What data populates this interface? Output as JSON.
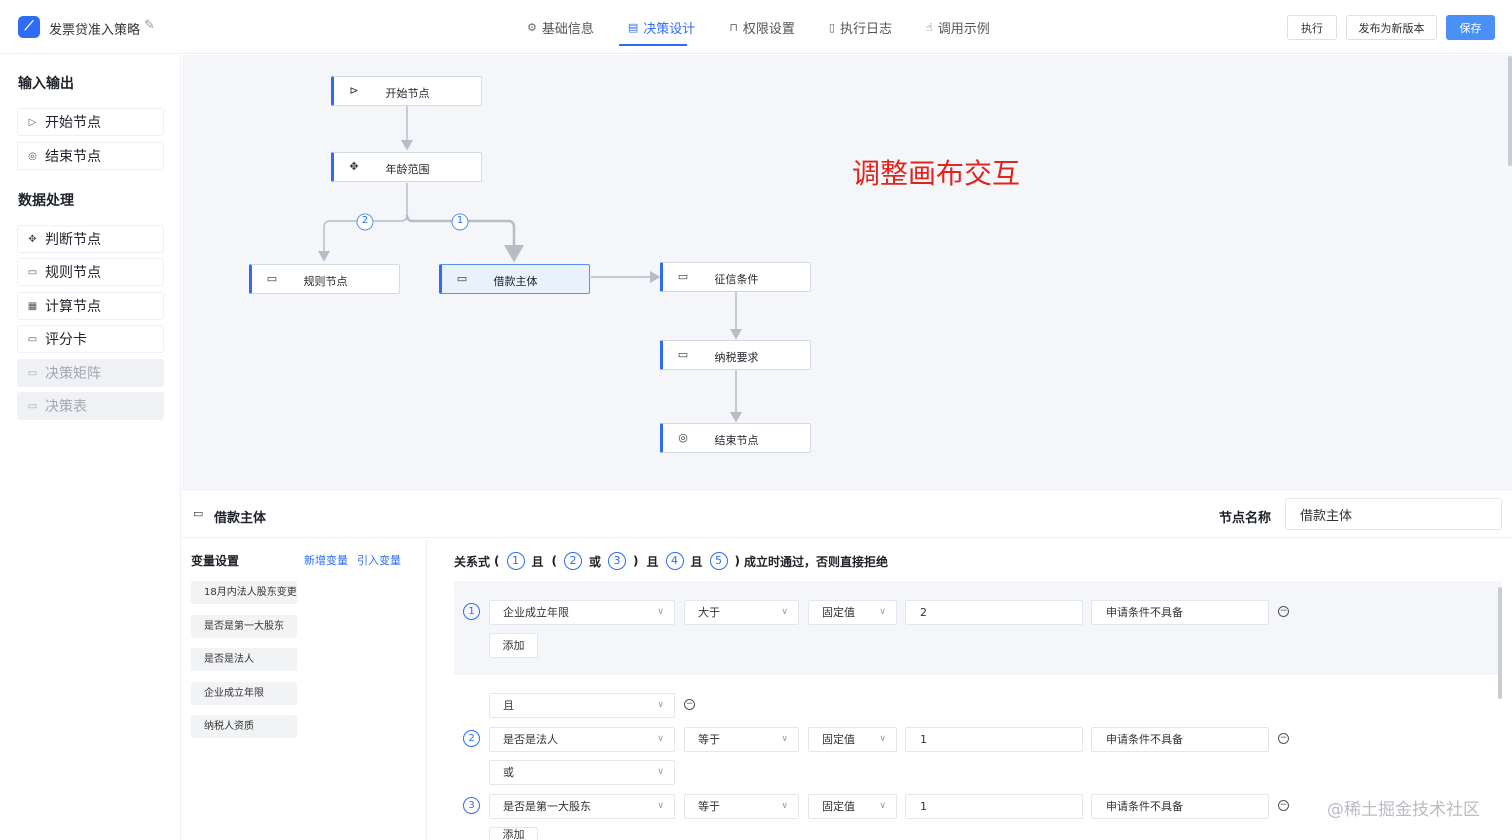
{
  "header": {
    "app_title": "发票贷准入策略",
    "tabs": [
      {
        "label": "基础信息",
        "icon": "settings-icon"
      },
      {
        "label": "决策设计",
        "icon": "design-icon"
      },
      {
        "label": "权限设置",
        "icon": "lock-icon"
      },
      {
        "label": "执行日志",
        "icon": "log-icon"
      },
      {
        "label": "调用示例",
        "icon": "hand-icon"
      }
    ],
    "active_tab": "决策设计",
    "buttons": {
      "run": "执行",
      "publish": "发布为新版本",
      "save": "保存"
    }
  },
  "sidebar": {
    "groups": [
      {
        "title": "输入输出",
        "items": [
          {
            "label": "开始节点",
            "icon": "play-icon"
          },
          {
            "label": "结束节点",
            "icon": "stop-icon"
          }
        ]
      },
      {
        "title": "数据处理",
        "items": [
          {
            "label": "判断节点",
            "icon": "move-icon"
          },
          {
            "label": "规则节点",
            "icon": "card-icon"
          },
          {
            "label": "计算节点",
            "icon": "calculator-icon"
          },
          {
            "label": "评分卡",
            "icon": "card-icon"
          },
          {
            "label": "决策矩阵",
            "icon": "card-icon",
            "disabled": true
          },
          {
            "label": "决策表",
            "icon": "card-icon",
            "disabled": true
          }
        ]
      }
    ]
  },
  "canvas": {
    "nodes": [
      {
        "id": "start",
        "label": "开始节点",
        "icon": "play-icon"
      },
      {
        "id": "age",
        "label": "年龄范围",
        "icon": "move-icon"
      },
      {
        "id": "rule",
        "label": "规则节点",
        "icon": "card-icon"
      },
      {
        "id": "borrower",
        "label": "借款主体",
        "icon": "card-icon",
        "selected": true
      },
      {
        "id": "credit",
        "label": "征信条件",
        "icon": "card-icon"
      },
      {
        "id": "tax",
        "label": "纳税要求",
        "icon": "card-icon"
      },
      {
        "id": "end",
        "label": "结束节点",
        "icon": "stop-icon"
      }
    ],
    "branch_labels": [
      "2",
      "1"
    ],
    "annotation": "调整画布交互"
  },
  "panel": {
    "title": "借款主体",
    "node_name_label": "节点名称",
    "node_name_value": "借款主体",
    "variables": {
      "title": "变量设置",
      "add_link": "新增变量",
      "import_link": "引入变量",
      "items": [
        "18月内法人股东变更",
        "是否是第一大股东",
        "是否是法人",
        "企业成立年限",
        "纳税人资质"
      ]
    },
    "formula": {
      "prefix": "关系式",
      "open": "(",
      "close": ")",
      "w_and": "且",
      "w_or": "或",
      "suffix": "成立时通过，否则直接拒绝",
      "n1": "1",
      "n2": "2",
      "n3": "3",
      "n4": "4",
      "n5": "5"
    },
    "conditions": [
      {
        "num": "1",
        "field": "企业成立年限",
        "op": "大于",
        "type": "固定值",
        "value": "2",
        "msg": "申请条件不具备"
      },
      {
        "num": "2",
        "field": "是否是法人",
        "op": "等于",
        "type": "固定值",
        "value": "1",
        "msg": "申请条件不具备"
      },
      {
        "num": "3",
        "field": "是否是第一大股东",
        "op": "等于",
        "type": "固定值",
        "value": "1",
        "msg": "申请条件不具备"
      }
    ],
    "connectors": {
      "and": "且",
      "or": "或"
    },
    "add_label": "添加"
  },
  "watermark": "@稀土掘金技术社区",
  "colors": {
    "accent": "#2f6cf6",
    "canvas_bg": "#f4f6f9",
    "annotation": "#e0261c"
  }
}
